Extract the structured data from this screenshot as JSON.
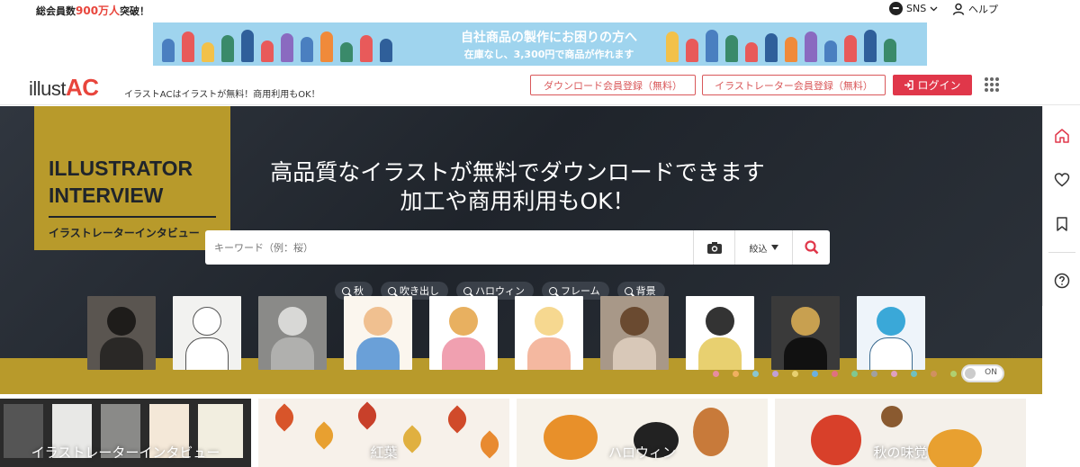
{
  "topbar": {
    "members_prefix": "総会員数",
    "members_num": "900万人",
    "members_suffix": "突破！",
    "sns_label": "SNS",
    "help_label": "ヘルプ"
  },
  "banner": {
    "line1": "自社商品の製作にお困りの方へ",
    "line2": "在庫なし、3,300円で商品が作れます"
  },
  "header": {
    "logo_main": "illust",
    "logo_ac": "AC",
    "tagline": "イラストACはイラストが無料！商用利用もOK！",
    "btn_download_register": "ダウンロード会員登録（無料）",
    "btn_illustrator_register": "イラストレーター会員登録（無料）",
    "btn_login": "ログイン"
  },
  "hero": {
    "interview_line1": "ILLUSTRATOR",
    "interview_line2": "INTERVIEW",
    "interview_jp": "イラストレーターインタビュー",
    "headline1": "高品質なイラストが無料でダウンロードできます",
    "headline2": "加工や商用利用もOK！",
    "search_placeholder": "キーワード（例：桜）",
    "filter_label": "絞込",
    "tags": [
      "秋",
      "吹き出し",
      "ハロウィン",
      "フレーム",
      "背景"
    ],
    "toggle_label": "ON",
    "dot_colors": [
      "#e88ca0",
      "#f0b060",
      "#8ac6d0",
      "#c0a0d8",
      "#e8d070",
      "#6bb0e0",
      "#e07080",
      "#80c890",
      "#a0a0a0",
      "#e0a0c0",
      "#70c0c0",
      "#d09060",
      "#b0d070"
    ]
  },
  "categories": [
    {
      "label": "イラストレーターインタビュー"
    },
    {
      "label": "紅葉"
    },
    {
      "label": "ハロウィン"
    },
    {
      "label": "秋の味覚"
    }
  ]
}
